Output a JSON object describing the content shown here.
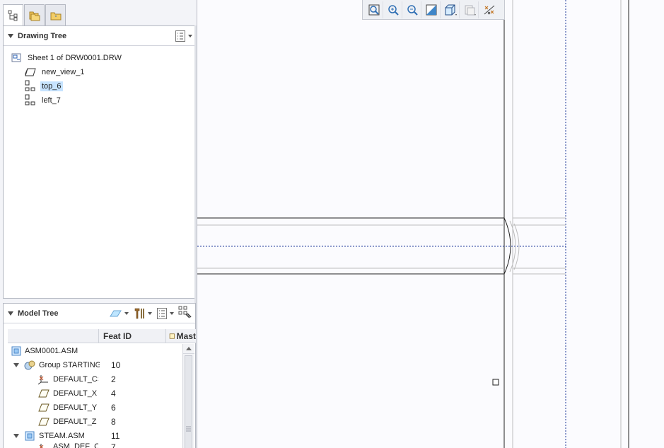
{
  "drawing_tree": {
    "title": "Drawing Tree",
    "items": [
      {
        "label": "Sheet 1 of DRW0001.DRW",
        "icon": "sheet-icon"
      },
      {
        "label": "new_view_1",
        "icon": "general-view-icon"
      },
      {
        "label": "top_6",
        "icon": "projection-view-icon",
        "selected": true
      },
      {
        "label": "left_7",
        "icon": "projection-view-icon"
      }
    ]
  },
  "model_tree": {
    "title": "Model Tree",
    "columns": [
      "Feat ID",
      "Mast"
    ],
    "rows": [
      {
        "name": "ASM0001.ASM",
        "feat_id": "",
        "icon": "assembly-icon"
      },
      {
        "name": "Group STARTING_",
        "feat_id": "10",
        "icon": "group-icon"
      },
      {
        "name": "DEFAULT_CS",
        "feat_id": "2",
        "icon": "coordinate-system-icon"
      },
      {
        "name": "DEFAULT_X",
        "feat_id": "4",
        "icon": "datum-plane-icon"
      },
      {
        "name": "DEFAULT_Y",
        "feat_id": "6",
        "icon": "datum-plane-icon"
      },
      {
        "name": "DEFAULT_Z",
        "feat_id": "8",
        "icon": "datum-plane-icon"
      },
      {
        "name": "STEAM.ASM",
        "feat_id": "11",
        "icon": "assembly-icon"
      },
      {
        "name": "ASM_DEF_CS",
        "feat_id": "7",
        "icon": "coordinate-system-icon"
      }
    ]
  },
  "graphics_toolbar": {
    "buttons": [
      "refit-icon",
      "zoom-in-icon",
      "zoom-out-icon",
      "repaint-icon",
      "display-style-icon",
      "saved-views-icon",
      "datum-display-icon"
    ]
  },
  "colors": {
    "selection": "#c6e3ff",
    "canvas": "#fbfbfe",
    "datum_line": "#1f3a9a"
  }
}
